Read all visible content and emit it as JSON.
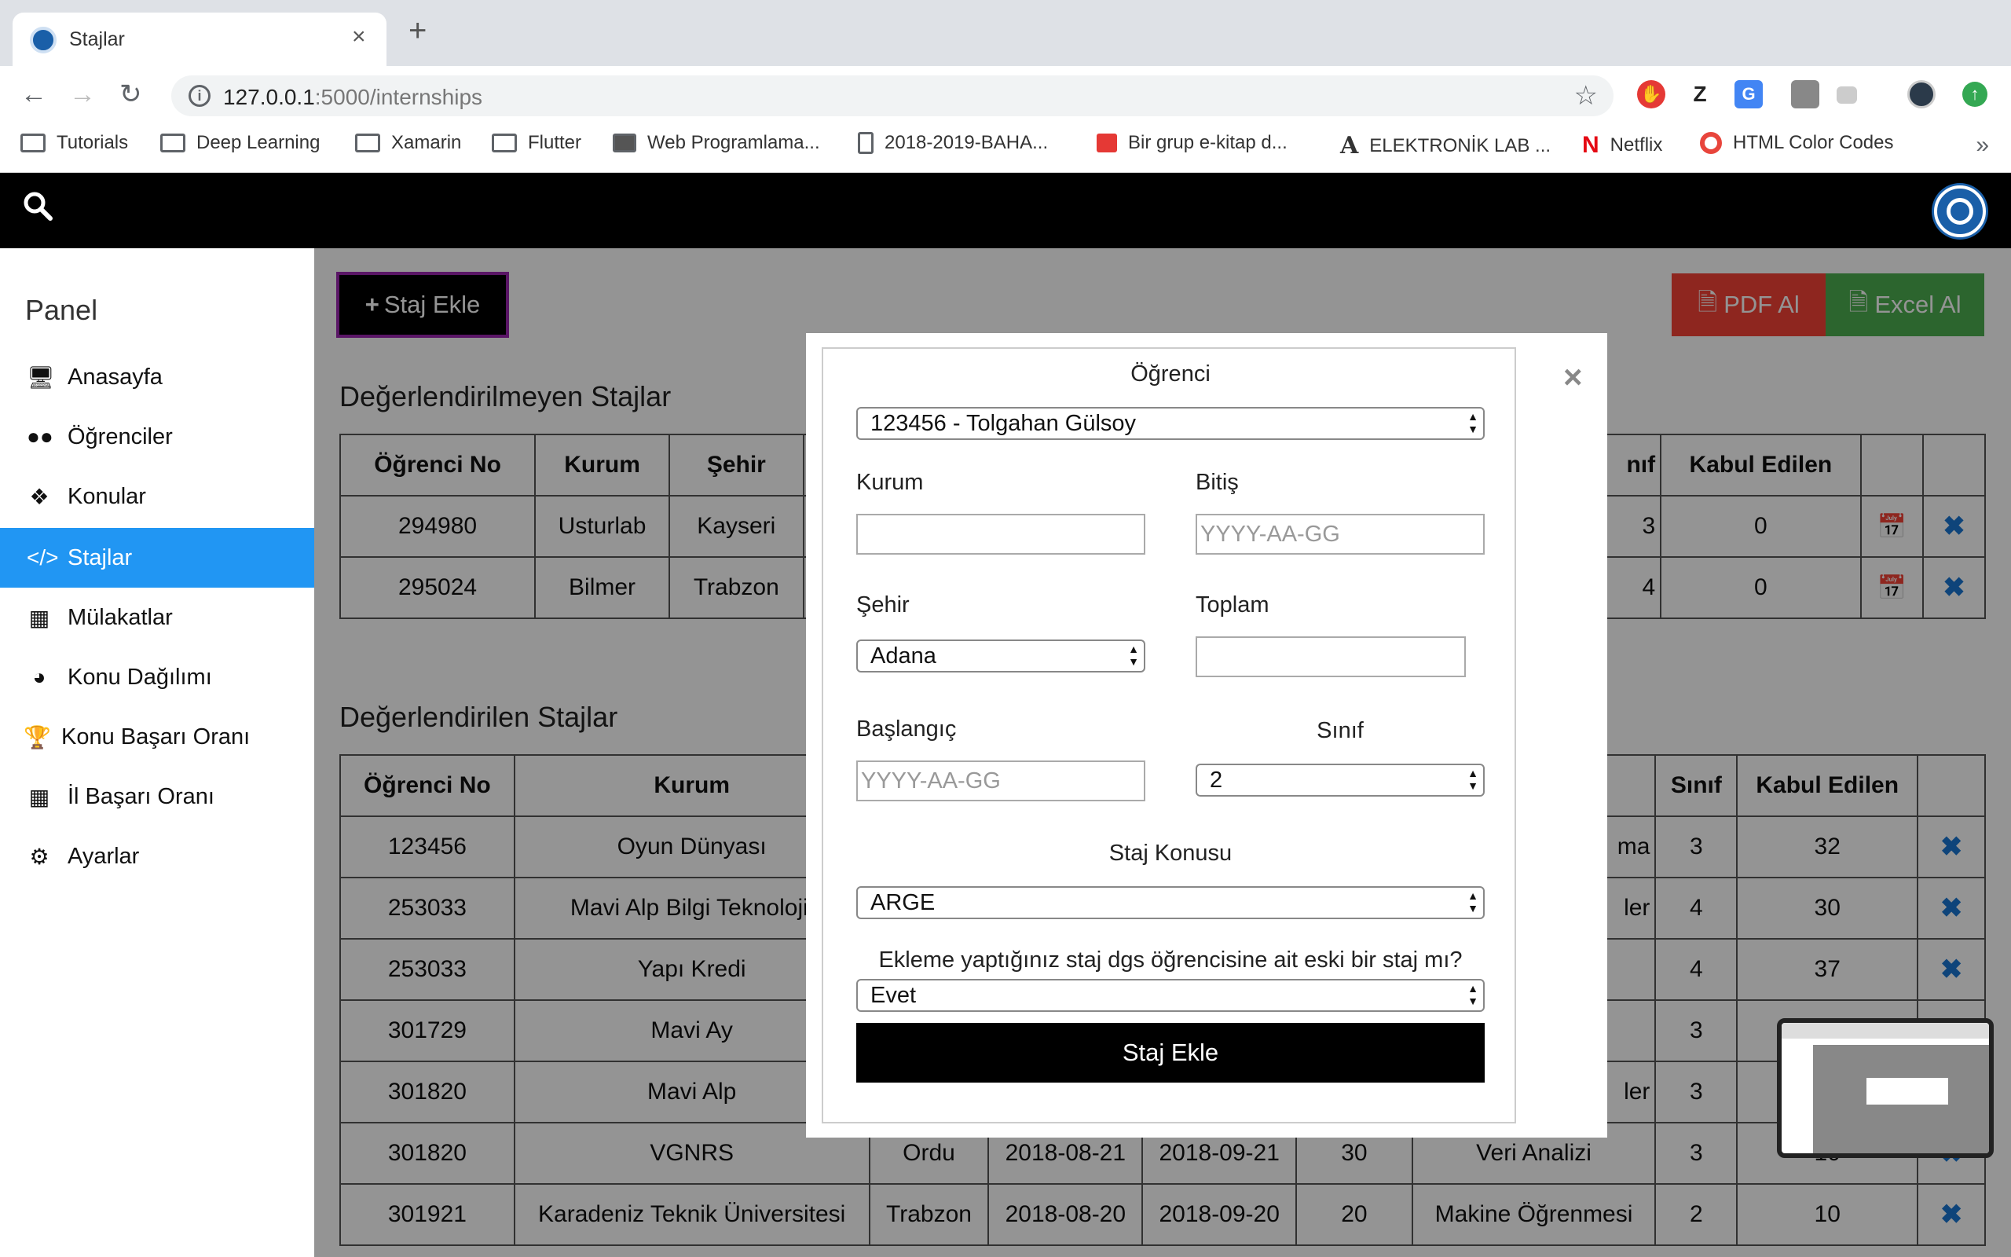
{
  "browser": {
    "tab_title": "Stajlar",
    "tab_close": "×",
    "new_tab": "+",
    "url_host": "127.0.0.1",
    "url_path": ":5000/internships",
    "bookmarks": [
      {
        "label": "Tutorials",
        "icon": "folder-icon"
      },
      {
        "label": "Deep Learning",
        "icon": "folder-icon"
      },
      {
        "label": "Xamarin",
        "icon": "folder-icon"
      },
      {
        "label": "Flutter",
        "icon": "folder-icon"
      },
      {
        "label": "Web Programlama...",
        "icon": "contact-icon"
      },
      {
        "label": "2018-2019-BAHA...",
        "icon": "document-icon"
      },
      {
        "label": "Bir grup e-kitap d...",
        "icon": "ebook-icon"
      },
      {
        "label": "ELEKTRONİK LAB ...",
        "icon": "font-a-icon"
      },
      {
        "label": "Netflix",
        "icon": "netflix-icon"
      },
      {
        "label": "HTML Color Codes",
        "icon": "color-wheel-icon"
      }
    ],
    "bookmarks_more": "»"
  },
  "sidebar": {
    "title": "Panel",
    "items": [
      {
        "label": "Anasayfa",
        "icon": "monitor-icon"
      },
      {
        "label": "Öğrenciler",
        "icon": "users-icon"
      },
      {
        "label": "Konular",
        "icon": "tags-icon"
      },
      {
        "label": "Stajlar",
        "icon": "code-icon"
      },
      {
        "label": "Mülakatlar",
        "icon": "calendar-icon"
      },
      {
        "label": "Konu Dağılımı",
        "icon": "pie-chart-icon"
      },
      {
        "label": "Konu Başarı Oranı",
        "icon": "trophy-icon"
      },
      {
        "label": "İl Başarı Oranı",
        "icon": "map-icon"
      },
      {
        "label": "Ayarlar",
        "icon": "gear-icon"
      }
    ]
  },
  "main": {
    "add_button": "Staj Ekle",
    "pdf_button": "PDF Al",
    "excel_button": "Excel Al",
    "unevaluated_title": "Değerlendirilmeyen Stajlar",
    "evaluated_title": "Değerlendirilen Stajlar",
    "unevaluated_table": {
      "headers": [
        "Öğrenci No",
        "Kurum",
        "Şehir",
        "nıf",
        "Kabul Edilen"
      ],
      "rows": [
        [
          "294980",
          "Usturlab",
          "Kayseri",
          "3",
          "0"
        ],
        [
          "295024",
          "Bilmer",
          "Trabzon",
          "4",
          "0"
        ]
      ]
    },
    "evaluated_table": {
      "headers": [
        "Öğrenci No",
        "Kurum",
        "",
        "",
        "",
        "",
        "",
        "Sınıf",
        "Kabul Edilen"
      ],
      "rows": [
        [
          "123456",
          "Oyun Dünyası",
          "",
          "",
          "",
          "",
          "ma",
          "3",
          "32"
        ],
        [
          "253033",
          "Mavi Alp Bilgi Teknolojil",
          "",
          "",
          "",
          "",
          "ler",
          "4",
          "30"
        ],
        [
          "253033",
          "Yapı Kredi",
          "",
          "",
          "",
          "",
          "",
          "4",
          "37"
        ],
        [
          "301729",
          "Mavi Ay",
          "",
          "",
          "",
          "",
          "",
          "3",
          ""
        ],
        [
          "301820",
          "Mavi Alp",
          "",
          "",
          "",
          "",
          "ler",
          "3",
          ""
        ],
        [
          "301820",
          "VGNRS",
          "Ordu",
          "2018-08-21",
          "2018-09-21",
          "30",
          "Veri Analizi",
          "3",
          "10"
        ],
        [
          "301921",
          "Karadeniz Teknik Üniversitesi",
          "Trabzon",
          "2018-08-20",
          "2018-09-20",
          "20",
          "Makine Öğrenmesi",
          "2",
          "10"
        ]
      ]
    }
  },
  "modal": {
    "close": "×",
    "student_label": "Öğrenci",
    "student_value": "123456 - Tolgahan Gülsoy",
    "kurum_label": "Kurum",
    "kurum_value": "",
    "bitis_label": "Bitiş",
    "bitis_placeholder": "YYYY-AA-GG",
    "sehir_label": "Şehir",
    "sehir_value": "Adana",
    "toplam_label": "Toplam",
    "toplam_value": "",
    "baslangic_label": "Başlangıç",
    "baslangic_placeholder": "YYYY-AA-GG",
    "sinif_label": "Sınıf",
    "sinif_value": "2",
    "konu_label": "Staj Konusu",
    "konu_value": "ARGE",
    "dgs_question": "Ekleme yaptığınız staj dgs öğrencisine ait eski bir staj mı?",
    "dgs_value": "Evet",
    "submit": "Staj Ekle"
  },
  "colors": {
    "accent_blue": "#2196f3",
    "pdf_red": "#f44336",
    "excel_green": "#4caf50",
    "icon_blue": "#1976d2"
  }
}
